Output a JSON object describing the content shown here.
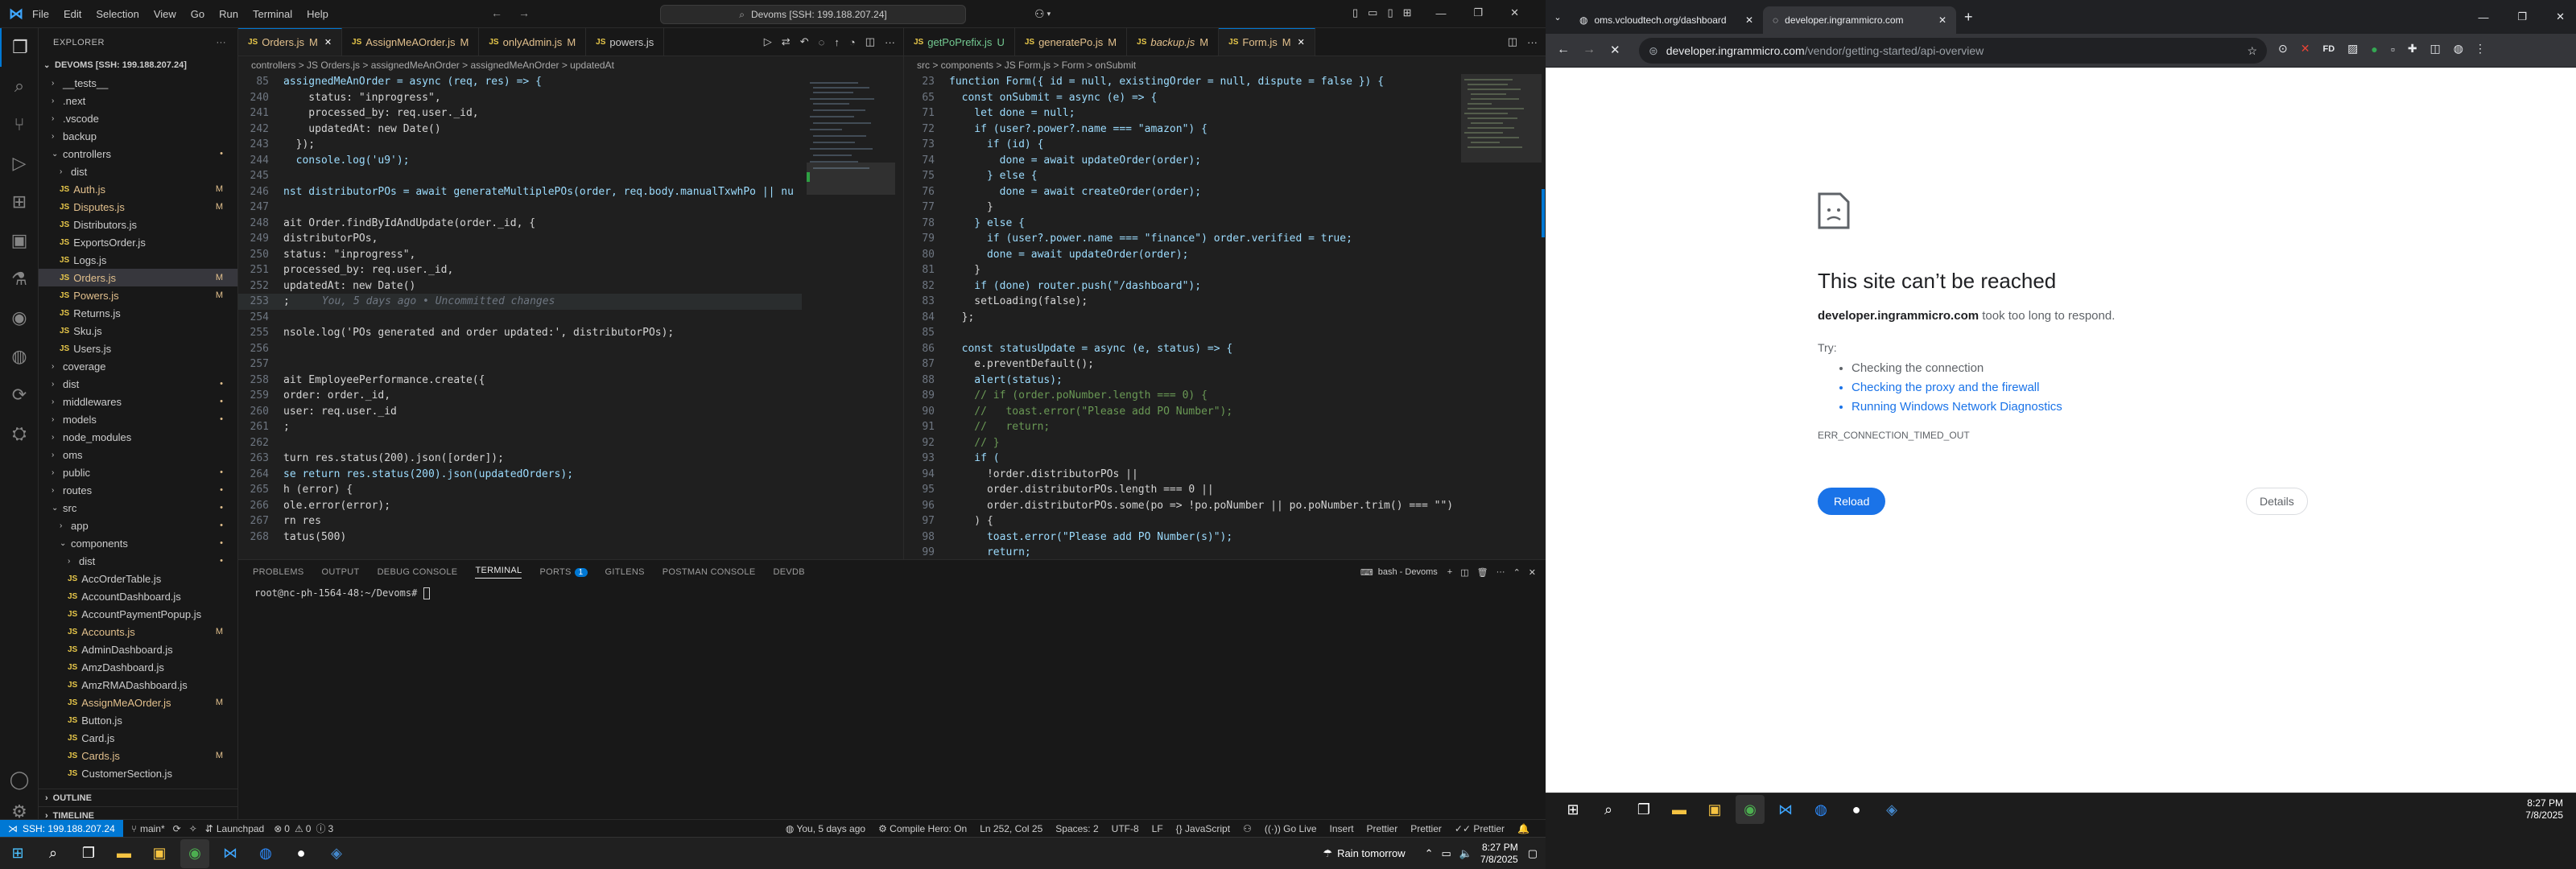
{
  "vscode": {
    "menu": [
      "File",
      "Edit",
      "Selection",
      "View",
      "Go",
      "Run",
      "Terminal",
      "Help"
    ],
    "command_center": "Devoms [SSH: 199.188.207.24]",
    "explorer": {
      "title": "EXPLORER",
      "root": "DEVOMS [SSH: 199.188.207.24]",
      "items": [
        {
          "label": "__tests__",
          "type": "folder",
          "depth": 0,
          "badge": ""
        },
        {
          "label": ".next",
          "type": "folder",
          "depth": 0,
          "badge": ""
        },
        {
          "label": ".vscode",
          "type": "folder",
          "depth": 0,
          "badge": ""
        },
        {
          "label": "backup",
          "type": "folder",
          "depth": 0,
          "badge": ""
        },
        {
          "label": "controllers",
          "type": "folder-open",
          "depth": 0,
          "badge": "•"
        },
        {
          "label": "dist",
          "type": "folder",
          "depth": 1,
          "badge": ""
        },
        {
          "label": "Auth.js",
          "type": "js",
          "depth": 1,
          "badge": "M"
        },
        {
          "label": "Disputes.js",
          "type": "js",
          "depth": 1,
          "badge": "M"
        },
        {
          "label": "Distributors.js",
          "type": "js",
          "depth": 1,
          "badge": ""
        },
        {
          "label": "ExportsOrder.js",
          "type": "js",
          "depth": 1,
          "badge": ""
        },
        {
          "label": "Logs.js",
          "type": "js",
          "depth": 1,
          "badge": ""
        },
        {
          "label": "Orders.js",
          "type": "js",
          "depth": 1,
          "badge": "M",
          "selected": true
        },
        {
          "label": "Powers.js",
          "type": "js",
          "depth": 1,
          "badge": "M"
        },
        {
          "label": "Returns.js",
          "type": "js",
          "depth": 1,
          "badge": ""
        },
        {
          "label": "Sku.js",
          "type": "js",
          "depth": 1,
          "badge": ""
        },
        {
          "label": "Users.js",
          "type": "js",
          "depth": 1,
          "badge": ""
        },
        {
          "label": "coverage",
          "type": "folder",
          "depth": 0,
          "badge": ""
        },
        {
          "label": "dist",
          "type": "folder",
          "depth": 0,
          "badge": "•"
        },
        {
          "label": "middlewares",
          "type": "folder",
          "depth": 0,
          "badge": "•"
        },
        {
          "label": "models",
          "type": "folder",
          "depth": 0,
          "badge": "•"
        },
        {
          "label": "node_modules",
          "type": "folder",
          "depth": 0,
          "badge": ""
        },
        {
          "label": "oms",
          "type": "folder",
          "depth": 0,
          "badge": ""
        },
        {
          "label": "public",
          "type": "folder",
          "depth": 0,
          "badge": "•"
        },
        {
          "label": "routes",
          "type": "folder",
          "depth": 0,
          "badge": "•"
        },
        {
          "label": "src",
          "type": "folder-open",
          "depth": 0,
          "badge": "•"
        },
        {
          "label": "app",
          "type": "folder",
          "depth": 1,
          "badge": "•"
        },
        {
          "label": "components",
          "type": "folder-open",
          "depth": 1,
          "badge": "•"
        },
        {
          "label": "dist",
          "type": "folder",
          "depth": 2,
          "badge": "•"
        },
        {
          "label": "AccOrderTable.js",
          "type": "js",
          "depth": 2,
          "badge": ""
        },
        {
          "label": "AccountDashboard.js",
          "type": "js",
          "depth": 2,
          "badge": ""
        },
        {
          "label": "AccountPaymentPopup.js",
          "type": "js",
          "depth": 2,
          "badge": ""
        },
        {
          "label": "Accounts.js",
          "type": "js",
          "depth": 2,
          "badge": "M"
        },
        {
          "label": "AdminDashboard.js",
          "type": "js",
          "depth": 2,
          "badge": ""
        },
        {
          "label": "AmzDashboard.js",
          "type": "js",
          "depth": 2,
          "badge": ""
        },
        {
          "label": "AmzRMADashboard.js",
          "type": "js",
          "depth": 2,
          "badge": ""
        },
        {
          "label": "AssignMeAOrder.js",
          "type": "js",
          "depth": 2,
          "badge": "M"
        },
        {
          "label": "Button.js",
          "type": "js",
          "depth": 2,
          "badge": ""
        },
        {
          "label": "Card.js",
          "type": "js",
          "depth": 2,
          "badge": ""
        },
        {
          "label": "Cards.js",
          "type": "js",
          "depth": 2,
          "badge": "M"
        },
        {
          "label": "CustomerSection.js",
          "type": "js",
          "depth": 2,
          "badge": ""
        }
      ],
      "outline": "OUTLINE",
      "timeline": "TIMELINE"
    },
    "left_editor": {
      "tabs": [
        {
          "label": "Orders.js",
          "badge": "M",
          "active": true
        },
        {
          "label": "AssignMeAOrder.js",
          "badge": "M"
        },
        {
          "label": "onlyAdmin.js",
          "badge": "M"
        },
        {
          "label": "powers.js",
          "badge": ""
        }
      ],
      "breadcrumb": "controllers > JS Orders.js > assignedMeAnOrder > assignedMeAnOrder > updatedAt",
      "lines": [
        {
          "n": "85",
          "t": "assignedMeAnOrder = async (req, res) => {"
        },
        {
          "n": "240",
          "t": "    status: \"inprogress\","
        },
        {
          "n": "241",
          "t": "    processed_by: req.user._id,"
        },
        {
          "n": "242",
          "t": "    updatedAt: new Date()"
        },
        {
          "n": "243",
          "t": "  });"
        },
        {
          "n": "244",
          "t": "  console.log('u9');"
        },
        {
          "n": "245",
          "t": ""
        },
        {
          "n": "246",
          "t": "nst distributorPOs = await generateMultiplePOs(order, req.body.manualTxwhPo || nu"
        },
        {
          "n": "247",
          "t": ""
        },
        {
          "n": "248",
          "t": "ait Order.findByIdAndUpdate(order._id, {"
        },
        {
          "n": "249",
          "t": "distributorPOs,"
        },
        {
          "n": "250",
          "t": "status: \"inprogress\","
        },
        {
          "n": "251",
          "t": "processed_by: req.user._id,"
        },
        {
          "n": "252",
          "t": "updatedAt: new Date()"
        },
        {
          "n": "253",
          "t": ";"
        },
        {
          "n": "254",
          "t": ""
        },
        {
          "n": "255",
          "t": "nsole.log('POs generated and order updated:', distributorPOs);"
        },
        {
          "n": "256",
          "t": ""
        },
        {
          "n": "257",
          "t": ""
        },
        {
          "n": "258",
          "t": "ait EmployeePerformance.create({"
        },
        {
          "n": "259",
          "t": "order: order._id,"
        },
        {
          "n": "260",
          "t": "user: req.user._id"
        },
        {
          "n": "261",
          "t": ";"
        },
        {
          "n": "262",
          "t": ""
        },
        {
          "n": "263",
          "t": "turn res.status(200).json([order]);"
        },
        {
          "n": "264",
          "t": "se return res.status(200).json(updatedOrders);"
        },
        {
          "n": "265",
          "t": "h (error) {"
        },
        {
          "n": "266",
          "t": "ole.error(error);"
        },
        {
          "n": "267",
          "t": "rn res"
        },
        {
          "n": "268",
          "t": "tatus(500)"
        }
      ],
      "blame": "You, 5 days ago • Uncommitted changes"
    },
    "right_editor": {
      "tabs": [
        {
          "label": "getPoPrefix.js",
          "badge": "U"
        },
        {
          "label": "generatePo.js",
          "badge": "M"
        },
        {
          "label": "backup.js",
          "badge": "M"
        },
        {
          "label": "Form.js",
          "badge": "M",
          "active": true
        }
      ],
      "breadcrumb": "src > components > JS Form.js > Form > onSubmit",
      "lines": [
        {
          "n": "23",
          "t": "function Form({ id = null, existingOrder = null, dispute = false }) {"
        },
        {
          "n": "65",
          "t": "  const onSubmit = async (e) => {"
        },
        {
          "n": "71",
          "t": "    let done = null;"
        },
        {
          "n": "72",
          "t": "    if (user?.power?.name === \"amazon\") {"
        },
        {
          "n": "73",
          "t": "      if (id) {"
        },
        {
          "n": "74",
          "t": "        done = await updateOrder(order);"
        },
        {
          "n": "75",
          "t": "      } else {"
        },
        {
          "n": "76",
          "t": "        done = await createOrder(order);"
        },
        {
          "n": "77",
          "t": "      }"
        },
        {
          "n": "78",
          "t": "    } else {"
        },
        {
          "n": "79",
          "t": "      if (user?.power.name === \"finance\") order.verified = true;"
        },
        {
          "n": "80",
          "t": "      done = await updateOrder(order);"
        },
        {
          "n": "81",
          "t": "    }"
        },
        {
          "n": "82",
          "t": "    if (done) router.push(\"/dashboard\");"
        },
        {
          "n": "83",
          "t": "    setLoading(false);"
        },
        {
          "n": "84",
          "t": "  };"
        },
        {
          "n": "85",
          "t": ""
        },
        {
          "n": "86",
          "t": "  const statusUpdate = async (e, status) => {"
        },
        {
          "n": "87",
          "t": "    e.preventDefault();"
        },
        {
          "n": "88",
          "t": "    alert(status);"
        },
        {
          "n": "89",
          "t": "    // if (order.poNumber.length === 0) {"
        },
        {
          "n": "90",
          "t": "    //   toast.error(\"Please add PO Number\");"
        },
        {
          "n": "91",
          "t": "    //   return;"
        },
        {
          "n": "92",
          "t": "    // }"
        },
        {
          "n": "93",
          "t": "    if ("
        },
        {
          "n": "94",
          "t": "      !order.distributorPOs ||"
        },
        {
          "n": "95",
          "t": "      order.distributorPOs.length === 0 ||"
        },
        {
          "n": "96",
          "t": "      order.distributorPOs.some(po => !po.poNumber || po.poNumber.trim() === \"\")"
        },
        {
          "n": "97",
          "t": "    ) {"
        },
        {
          "n": "98",
          "t": "      toast.error(\"Please add PO Number(s)\");"
        },
        {
          "n": "99",
          "t": "      return;"
        }
      ]
    },
    "panel": {
      "tabs": [
        "PROBLEMS",
        "OUTPUT",
        "DEBUG CONSOLE",
        "TERMINAL",
        "PORTS",
        "GITLENS",
        "POSTMAN CONSOLE",
        "DEVDB"
      ],
      "ports_count": "1",
      "active_tab": "TERMINAL",
      "shell_label": "bash - Devoms",
      "prompt": "root@nc-ph-1564-48:~/Devoms# "
    },
    "statusbar": {
      "remote": "SSH: 199.188.207.24",
      "branch": "main*",
      "errors": "0",
      "warnings": "0",
      "info": "3",
      "launchpad": "Launchpad",
      "blame": "You, 5 days ago",
      "compile_hero": "Compile Hero: On",
      "position": "Ln 252, Col 25",
      "spaces": "Spaces: 2",
      "encoding": "UTF-8",
      "eol": "LF",
      "language": "JavaScript",
      "golive": "Go Live",
      "insert": "Insert",
      "prettier1": "Prettier",
      "prettier2": "Prettier",
      "prettier3": "Prettier"
    }
  },
  "taskbar_left": {
    "weather": "Rain tomorrow",
    "time": "8:27 PM",
    "date": "7/8/2025"
  },
  "chrome": {
    "tabs": [
      {
        "title": "oms.vcloudtech.org/dashboard",
        "active": false
      },
      {
        "title": "developer.ingrammicro.com",
        "active": true,
        "loading": true
      }
    ],
    "url_host": "developer.ingrammicro.com",
    "url_path": "/vendor/getting-started/api-overview",
    "error": {
      "title": "This site can’t be reached",
      "host": "developer.ingrammicro.com",
      "message": " took too long to respond.",
      "try": "Try:",
      "suggestions": [
        {
          "text": "Checking the connection",
          "link": false
        },
        {
          "text": "Checking the proxy and the firewall",
          "link": true
        },
        {
          "text": "Running Windows Network Diagnostics",
          "link": true
        }
      ],
      "code": "ERR_CONNECTION_TIMED_OUT",
      "reload": "Reload",
      "details": "Details"
    }
  },
  "taskbar_right": {
    "time": "8:27 PM",
    "date": "7/8/2025"
  },
  "colors": {
    "accent": "#0078d4",
    "modified": "#e2c08d",
    "link": "#1a73e8",
    "reload": "#1a73e8"
  }
}
